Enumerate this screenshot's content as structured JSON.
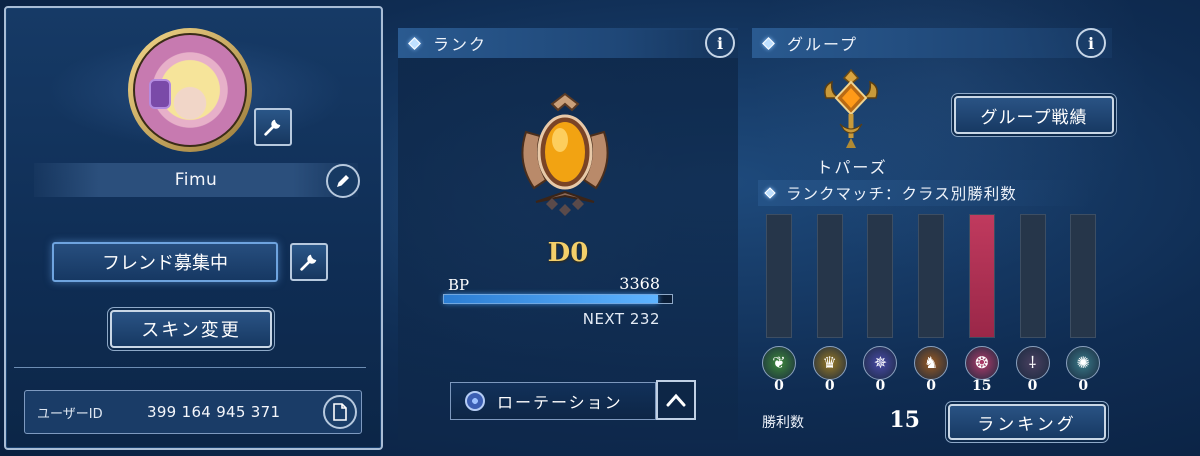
{
  "profile": {
    "name": "Fimu",
    "friend_label": "フレンド募集中",
    "skin_label": "スキン変更",
    "user_id_label": "ユーザーID",
    "user_id_value": "399 164 945 371"
  },
  "rank": {
    "header": "ランク",
    "value": "D0",
    "bp_label": "BP",
    "bp_value": "3368",
    "bp_progress_percent": 94,
    "next_text": "NEXT 232",
    "rotation_label": "ローテーション"
  },
  "group": {
    "header": "グループ",
    "name": "トパーズ",
    "record_label": "グループ戦績",
    "class_wins_title": "ランクマッチ：クラス別勝利数",
    "classes": [
      {
        "icon": "leaf-icon",
        "glyph": "❦",
        "color": "#3f8a3a",
        "wins": "0"
      },
      {
        "icon": "crown-icon",
        "glyph": "♛",
        "color": "#9a7a24",
        "wins": "0"
      },
      {
        "icon": "magic-circle-icon",
        "glyph": "✵",
        "color": "#4a4aa8",
        "wins": "0"
      },
      {
        "icon": "dragon-icon",
        "glyph": "♞",
        "color": "#9a5a22",
        "wins": "0"
      },
      {
        "icon": "bat-icon",
        "glyph": "❂",
        "color": "#b33b6a",
        "wins": "15"
      },
      {
        "icon": "bone-claw-icon",
        "glyph": "⸸",
        "color": "#4a4060",
        "wins": "0"
      },
      {
        "icon": "nature-spirit-icon",
        "glyph": "✺",
        "color": "#3a7a88",
        "wins": "0"
      }
    ],
    "class_max": 15,
    "wins_label": "勝利数",
    "wins_total": "15",
    "ranking_label": "ランキング"
  },
  "colors": {
    "background": "#0f2c52",
    "accent_gold": "#f3cf6a",
    "bp_bar": "#3b95e8",
    "class_bar_fill": "#b8325a"
  }
}
